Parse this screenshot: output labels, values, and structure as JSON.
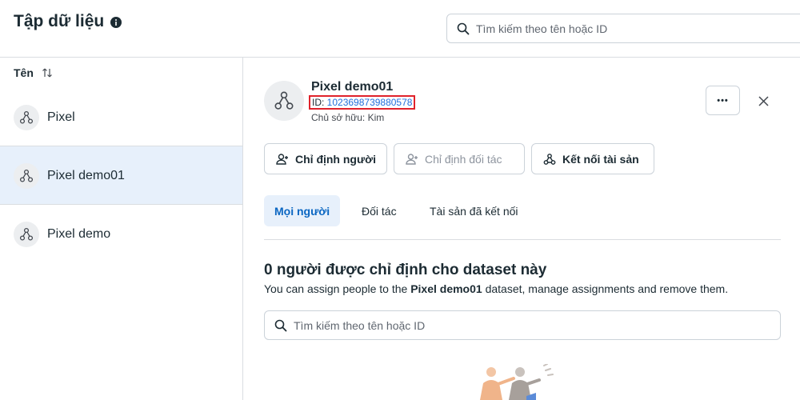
{
  "header": {
    "title": "Tập dữ liệu",
    "search_placeholder": "Tìm kiếm theo tên hoặc ID"
  },
  "sidebar": {
    "sort_label": "Tên",
    "items": [
      {
        "label": "Pixel",
        "selected": false
      },
      {
        "label": "Pixel demo01",
        "selected": true
      },
      {
        "label": "Pixel demo",
        "selected": false
      }
    ]
  },
  "detail": {
    "name": "Pixel demo01",
    "id_prefix": "ID: ",
    "id_value": "1023698739880578",
    "owner": "Chủ sở hữu: Kim",
    "more_label": "•••",
    "buttons": {
      "assign_people": "Chỉ định người",
      "assign_partner": "Chỉ định đối tác",
      "connect_assets": "Kết nối tài sản"
    },
    "tabs": [
      {
        "label": "Mọi người",
        "active": true
      },
      {
        "label": "Đối tác",
        "active": false
      },
      {
        "label": "Tài sản đã kết nối",
        "active": false
      }
    ],
    "section": {
      "title": "0 người được chỉ định cho dataset này",
      "desc_before": "You can assign people to the ",
      "desc_bold": "Pixel demo01",
      "desc_after": " dataset, manage assignments and remove them."
    },
    "search_placeholder": "Tìm kiếm theo tên hoặc ID"
  },
  "colors": {
    "accent": "#0a66c2",
    "selected_bg": "#e7f0fb",
    "highlight_border": "#e0222b",
    "link": "#216fdb"
  },
  "icons": {
    "info": "info-icon",
    "search": "search-icon",
    "sort": "sort-arrows-icon",
    "dataset": "dataset-nodes-icon",
    "close": "close-icon",
    "add_person": "add-person-icon",
    "connect": "connect-assets-icon"
  }
}
